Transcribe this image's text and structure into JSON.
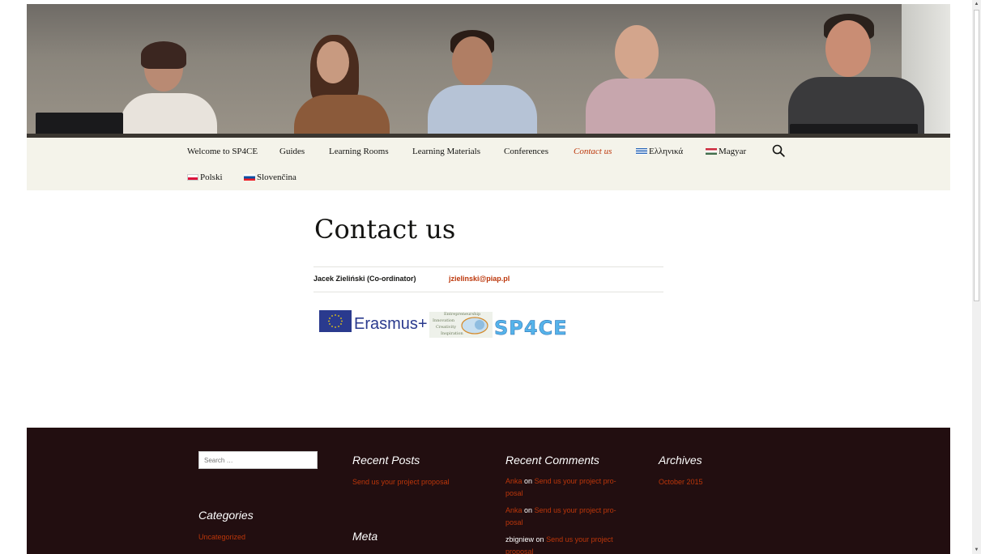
{
  "nav": {
    "items": [
      {
        "label": "Welcome to SP4CE"
      },
      {
        "label": "Guides"
      },
      {
        "label": "Learning Rooms"
      },
      {
        "label": "Learning Materials"
      },
      {
        "label": "Conferences"
      },
      {
        "label": "Contact us"
      },
      {
        "label": "Ελληνικά"
      },
      {
        "label": "Magyar"
      },
      {
        "label": "Polski"
      },
      {
        "label": "Slovenčina"
      }
    ],
    "active": "Contact us"
  },
  "page": {
    "title": "Contact us",
    "contact": {
      "name": "Jacek Zieliński (Co-ordinator)",
      "email": "jzielinski@piap.pl"
    },
    "logos": {
      "erasmus": "Erasmus+",
      "sp4ce": "SP4CE",
      "sp4ce_words": [
        "Entrepreneurship",
        "Innovation",
        "Creativity",
        "Inspiration"
      ]
    }
  },
  "footer": {
    "search_placeholder": "Search …",
    "recent_posts": {
      "title": "Recent Posts",
      "items": [
        "Send us your project proposal"
      ]
    },
    "recent_comments": {
      "title": "Recent Comments",
      "items": [
        {
          "author": "Anka",
          "on": "on",
          "post_line1": "Send us your project pro-",
          "post_line2": "posal"
        },
        {
          "author": "Anka",
          "on": "on",
          "post_line1": "Send us your project pro-",
          "post_line2": "posal"
        },
        {
          "author": "zbigniew",
          "on": "on",
          "post_line1": "Send us your project",
          "post_line2": "proposal"
        }
      ]
    },
    "archives": {
      "title": "Archives",
      "items": [
        "October 2015"
      ]
    },
    "categories": {
      "title": "Categories",
      "items": [
        "Uncategorized"
      ]
    },
    "meta": {
      "title": "Meta"
    }
  },
  "colors": {
    "accent": "#bc360a",
    "navbar_bg": "#f4f3ea",
    "footer_bg": "#220e10"
  }
}
